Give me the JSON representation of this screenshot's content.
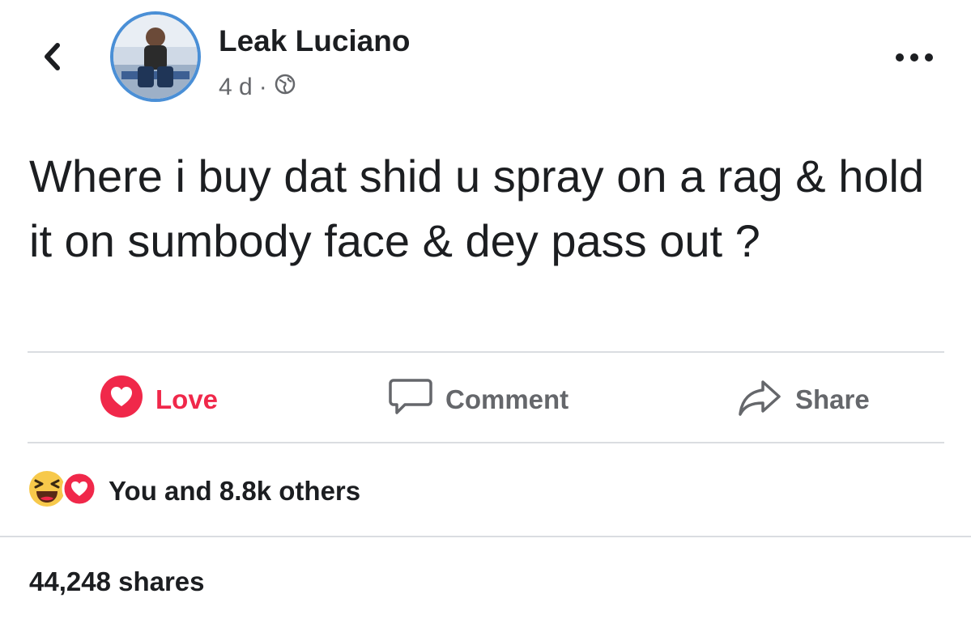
{
  "post": {
    "author": "Leak Luciano",
    "time": "4 d",
    "separator": "·",
    "text": "Where i buy dat shid u spray on a rag & hold it on sumbody face & dey pass out ?"
  },
  "actions": {
    "love_label": "Love",
    "comment_label": "Comment",
    "share_label": "Share"
  },
  "reactions": {
    "summary": "You and 8.8k others",
    "icons": [
      "haha-emoji-icon",
      "love-reaction-icon"
    ]
  },
  "shares": {
    "count_text": "44,248 shares"
  },
  "icons": {
    "back": "chevron-left-icon",
    "more": "more-dots-icon",
    "audience": "globe-icon",
    "comment": "comment-bubble-icon",
    "share": "share-arrow-icon"
  },
  "colors": {
    "love": "#f0284a",
    "meta_text": "#65676b",
    "avatar_ring": "#4a8fd6",
    "divider": "#dadde1"
  }
}
